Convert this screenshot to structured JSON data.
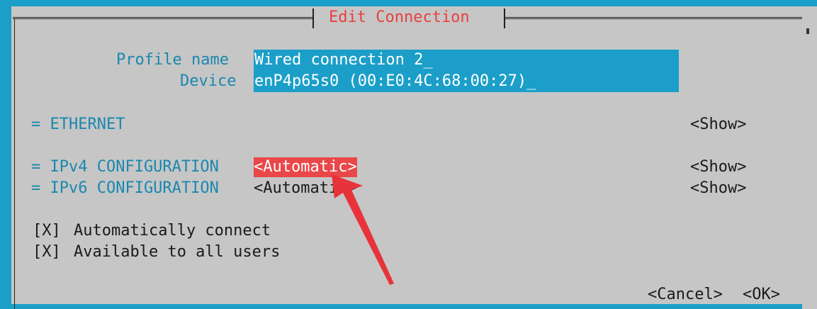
{
  "dialog": {
    "title": "Edit Connection"
  },
  "profile": {
    "label": "Profile name",
    "value": "Wired connection 2_"
  },
  "device": {
    "label": "Device",
    "value": "enP4p65s0 (00:E0:4C:68:00:27)_"
  },
  "ethernet": {
    "label": "= ETHERNET",
    "show": "<Show>"
  },
  "ipv4": {
    "label": "= IPv4 CONFIGURATION",
    "mode": "<Automatic>",
    "show": "<Show>"
  },
  "ipv6": {
    "label": "= IPv6 CONFIGURATION",
    "mode": "<Automatic>",
    "show": "<Show>"
  },
  "checkboxes": [
    {
      "mark": "[X]",
      "label": "Automatically connect"
    },
    {
      "mark": "[X]",
      "label": "Available to all users"
    }
  ],
  "buttons": {
    "cancel": "<Cancel>",
    "ok": "<OK>"
  },
  "colors": {
    "terminal_bg": "#1b9fc8",
    "dialog_bg": "#c6c6c6",
    "title": "#e8413f",
    "label": "#1a88ae",
    "focus": "#e9474a",
    "annotation_arrow": "#e8333a"
  },
  "icons": {
    "annotation": "red-arrow-icon"
  }
}
